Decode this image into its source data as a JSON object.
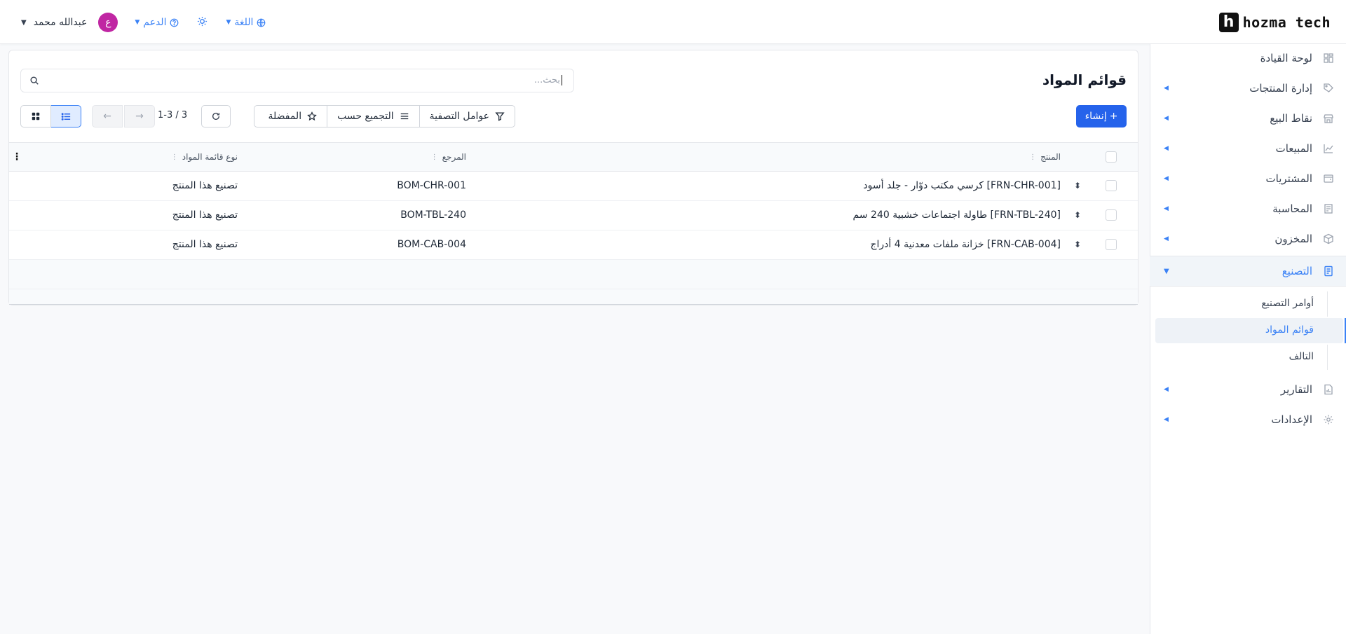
{
  "brand": {
    "logo_letter": "h",
    "name": "hozma tech"
  },
  "header": {
    "user_name": "عبدالله محمد",
    "avatar_letter": "ع",
    "support_label": "الدعم",
    "language_label": "اللغة"
  },
  "sidebar": {
    "items": [
      {
        "label": "لوحة القيادة",
        "icon": "grid-icon"
      },
      {
        "label": "إدارة المنتجات",
        "icon": "tag-icon"
      },
      {
        "label": "نقاط البيع",
        "icon": "store-icon"
      },
      {
        "label": "المبيعات",
        "icon": "chart-line-icon"
      },
      {
        "label": "المشتريات",
        "icon": "wallet-icon"
      },
      {
        "label": "المحاسبة",
        "icon": "ledger-icon"
      },
      {
        "label": "المخزون",
        "icon": "box-icon"
      },
      {
        "label": "التصنيع",
        "icon": "document-icon"
      },
      {
        "label": "التقارير",
        "icon": "report-icon"
      },
      {
        "label": "الإعدادات",
        "icon": "gear-icon"
      }
    ],
    "sub_items": [
      {
        "label": "أوامر التصنيع"
      },
      {
        "label": "قوائم المواد"
      },
      {
        "label": "التالف"
      }
    ]
  },
  "main": {
    "title": "قوائم المواد",
    "search_placeholder": "بحث...",
    "create_label": "إنشاء",
    "filters_label": "عوامل التصفية",
    "group_by_label": "التجميع حسب",
    "favorites_label": "المفضلة",
    "pager_text": "1-3 / 3"
  },
  "table": {
    "columns": [
      "المنتج",
      "المرجع",
      "نوع قائمة المواد"
    ],
    "rows": [
      {
        "product": "[FRN-CHR-001] كرسي مكتب دوّار - جلد أسود",
        "reference": "BOM-CHR-001",
        "type": "تصنيع هذا المنتج"
      },
      {
        "product": "[FRN-TBL-240] طاولة اجتماعات خشبية 240 سم",
        "reference": "BOM-TBL-240",
        "type": "تصنيع هذا المنتج"
      },
      {
        "product": "[FRN-CAB-004] خزانة ملفات معدنية 4 أدراج",
        "reference": "BOM-CAB-004",
        "type": "تصنيع هذا المنتج"
      }
    ]
  },
  "colors": {
    "accent": "#2563eb",
    "avatar": "#c026a3"
  }
}
